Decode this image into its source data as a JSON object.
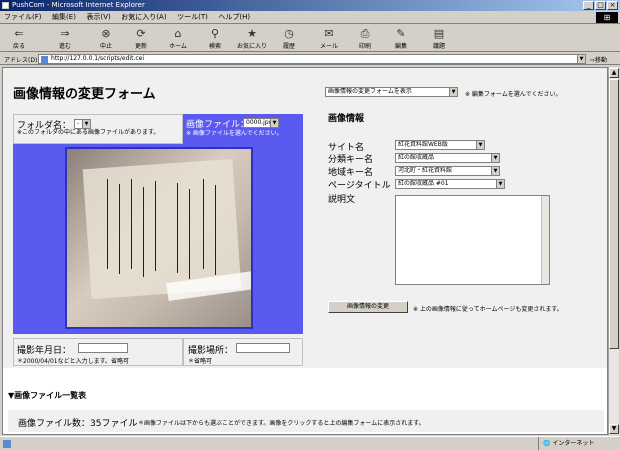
{
  "window": {
    "title": "PushCom - Microsoft Internet Explorer"
  },
  "menu": [
    "ファイル(F)",
    "編集(E)",
    "表示(V)",
    "お気に入り(A)",
    "ツール(T)",
    "ヘルプ(H)"
  ],
  "toolbar": {
    "back": "戻る",
    "forward": "進む",
    "stop": "中止",
    "refresh": "更新",
    "home": "ホーム",
    "search": "検索",
    "favorites": "お気に入り",
    "history": "履歴",
    "mail": "メール",
    "print": "印刷",
    "edit": "編集",
    "discuss": "議題"
  },
  "address": {
    "label": "アドレス(D)",
    "url": "http://127.0.0.1/scripts/edit.cei",
    "go": "移動"
  },
  "page": {
    "title": "画像情報の変更フォーム",
    "form_select": "画像情報の変更フォームを表示",
    "form_select_note": "※ 編集フォームを選んでください。",
    "folder_label": "フォルダ名：",
    "folder_value": "-",
    "folder_note": "※このフォルダの中にある画像ファイルがあります。",
    "file_label": "画像ファイル：",
    "file_value": "0000.jpg",
    "file_note": "※ 画像ファイルを選んでください。",
    "date_label": "撮影年月日：",
    "date_note": "＊2000/04/01などと入力します。省略可",
    "place_label": "撮影場所：",
    "place_note": "＊省略可",
    "info_heading": "画像情報",
    "fields": [
      {
        "label": "サイト名",
        "value": "紅花資料館WEB版"
      },
      {
        "label": "分類キー名",
        "value": "紅の館収蔵品"
      },
      {
        "label": "地域キー名",
        "value": "河北町・紅花資料館"
      },
      {
        "label": "ページタイトル",
        "value": "紅の館収蔵品 #01"
      }
    ],
    "description_label": "説明文",
    "update_button": "画像情報の変更",
    "update_note": "※ 上の画像情報に従ってホームページも変更されます。",
    "list_heading": "▼画像ファイル一覧表",
    "file_count": "画像ファイル数：35ファイル",
    "file_count_note": "＊画像ファイルは下からも選ぶことができます。画像をクリックすると上の編集フォームに表示されます。"
  },
  "status": {
    "zone": "インターネット"
  },
  "colors": {
    "accent": "#5a5af0",
    "titlebar": "#0a246a"
  }
}
